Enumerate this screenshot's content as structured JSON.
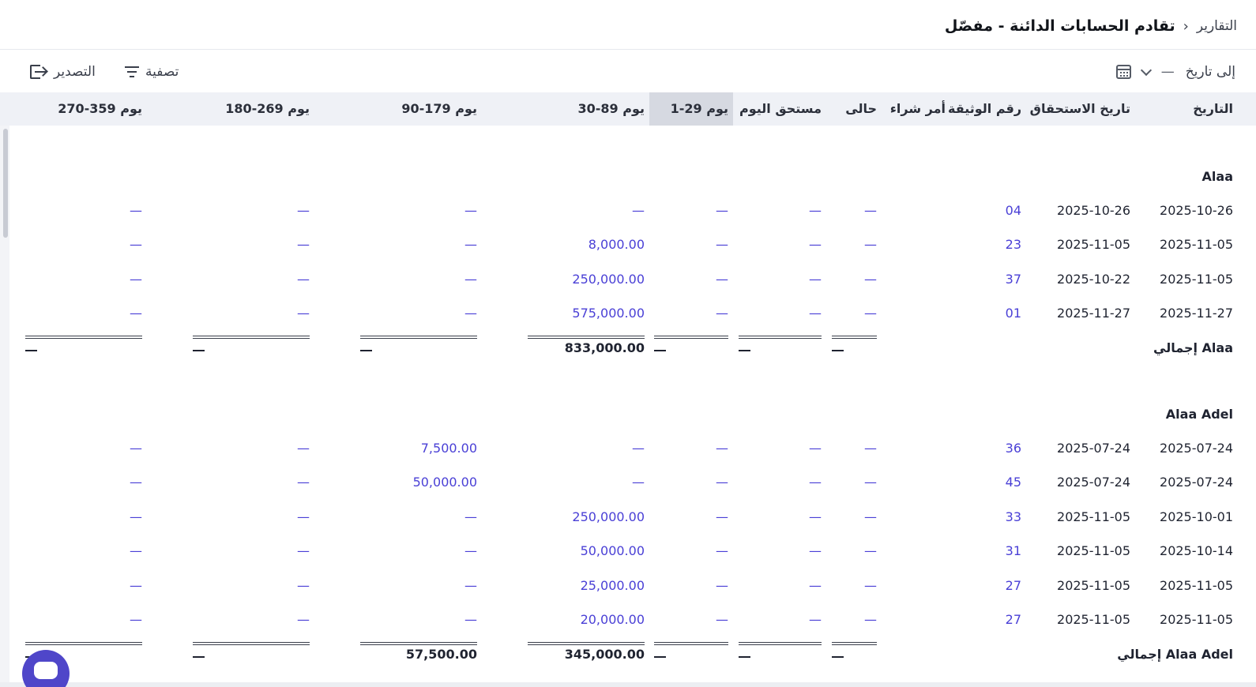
{
  "breadcrumb": {
    "parent": "التقارير",
    "separator": "›",
    "title": "تقادم الحسابات الدائنة - مفصّل"
  },
  "toolbar": {
    "to_date_label": "إلى تاريخ",
    "to_date_value": "—",
    "filter_label": "تصفية",
    "export_label": "التصدير",
    "icons": {
      "calendar": "calendar-icon",
      "chevron": "chevron-down-icon",
      "filter": "filter-icon",
      "export": "export-icon"
    }
  },
  "columns": [
    {
      "key": "date",
      "label": "التاريخ"
    },
    {
      "key": "due_date",
      "label": "تاريخ الاستحقاق"
    },
    {
      "key": "doc_no",
      "label": "رقم الوثيقة"
    },
    {
      "key": "po",
      "label": "أمر شراء"
    },
    {
      "key": "current",
      "label": "حالى"
    },
    {
      "key": "due_today",
      "label": "مستحق اليوم"
    },
    {
      "key": "b1_29",
      "label": "1-29 يوم",
      "active": true
    },
    {
      "key": "b30_89",
      "label": "30-89 يوم"
    },
    {
      "key": "b90_179",
      "label": "90-179 يوم"
    },
    {
      "key": "b180_269",
      "label": "180-269 يوم"
    },
    {
      "key": "b270_359",
      "label": "270-359 يوم"
    }
  ],
  "groups": [
    {
      "name": "Alaa",
      "rows": [
        {
          "date": "2025-10-26",
          "due_date": "2025-10-26",
          "doc_no": "04",
          "current": "—",
          "due_today": "—",
          "b1_29": "—",
          "b30_89": "—",
          "b90_179": "—",
          "b180_269": "—",
          "b270_359": "—"
        },
        {
          "date": "2025-11-05",
          "due_date": "2025-11-05",
          "doc_no": "23",
          "current": "—",
          "due_today": "—",
          "b1_29": "—",
          "b30_89": "8,000.00",
          "b90_179": "—",
          "b180_269": "—",
          "b270_359": "—"
        },
        {
          "date": "2025-11-05",
          "due_date": "2025-10-22",
          "doc_no": "37",
          "current": "—",
          "due_today": "—",
          "b1_29": "—",
          "b30_89": "250,000.00",
          "b90_179": "—",
          "b180_269": "—",
          "b270_359": "—"
        },
        {
          "date": "2025-11-27",
          "due_date": "2025-11-27",
          "doc_no": "01",
          "current": "—",
          "due_today": "—",
          "b1_29": "—",
          "b30_89": "575,000.00",
          "b90_179": "—",
          "b180_269": "—",
          "b270_359": "—"
        }
      ],
      "total": {
        "label": "إجمالي Alaa",
        "current": "—",
        "due_today": "—",
        "b1_29": "—",
        "b30_89": "833,000.00",
        "b90_179": "—",
        "b180_269": "—",
        "b270_359": "—"
      }
    },
    {
      "name": "Alaa Adel",
      "rows": [
        {
          "date": "2025-07-24",
          "due_date": "2025-07-24",
          "doc_no": "36",
          "current": "—",
          "due_today": "—",
          "b1_29": "—",
          "b30_89": "—",
          "b90_179": "7,500.00",
          "b180_269": "—",
          "b270_359": "—"
        },
        {
          "date": "2025-07-24",
          "due_date": "2025-07-24",
          "doc_no": "45",
          "current": "—",
          "due_today": "—",
          "b1_29": "—",
          "b30_89": "—",
          "b90_179": "50,000.00",
          "b180_269": "—",
          "b270_359": "—"
        },
        {
          "date": "2025-10-01",
          "due_date": "2025-11-05",
          "doc_no": "33",
          "current": "—",
          "due_today": "—",
          "b1_29": "—",
          "b30_89": "250,000.00",
          "b90_179": "—",
          "b180_269": "—",
          "b270_359": "—"
        },
        {
          "date": "2025-10-14",
          "due_date": "2025-11-05",
          "doc_no": "31",
          "current": "—",
          "due_today": "—",
          "b1_29": "—",
          "b30_89": "50,000.00",
          "b90_179": "—",
          "b180_269": "—",
          "b270_359": "—"
        },
        {
          "date": "2025-11-05",
          "due_date": "2025-11-05",
          "doc_no": "27",
          "current": "—",
          "due_today": "—",
          "b1_29": "—",
          "b30_89": "25,000.00",
          "b90_179": "—",
          "b180_269": "—",
          "b270_359": "—"
        },
        {
          "date": "2025-11-05",
          "due_date": "2025-11-05",
          "doc_no": "27",
          "current": "—",
          "due_today": "—",
          "b1_29": "—",
          "b30_89": "20,000.00",
          "b90_179": "—",
          "b180_269": "—",
          "b270_359": "—"
        }
      ],
      "total": {
        "label": "إجمالي Alaa Adel",
        "current": "—",
        "due_today": "—",
        "b1_29": "—",
        "b30_89": "345,000.00",
        "b90_179": "57,500.00",
        "b180_269": "—",
        "b270_359": "—"
      }
    }
  ],
  "colors": {
    "link": "#4a40d6",
    "header_bg": "#eff1f6",
    "active_header_bg": "#d6d9e1",
    "chat_button": "#4f46c9"
  }
}
